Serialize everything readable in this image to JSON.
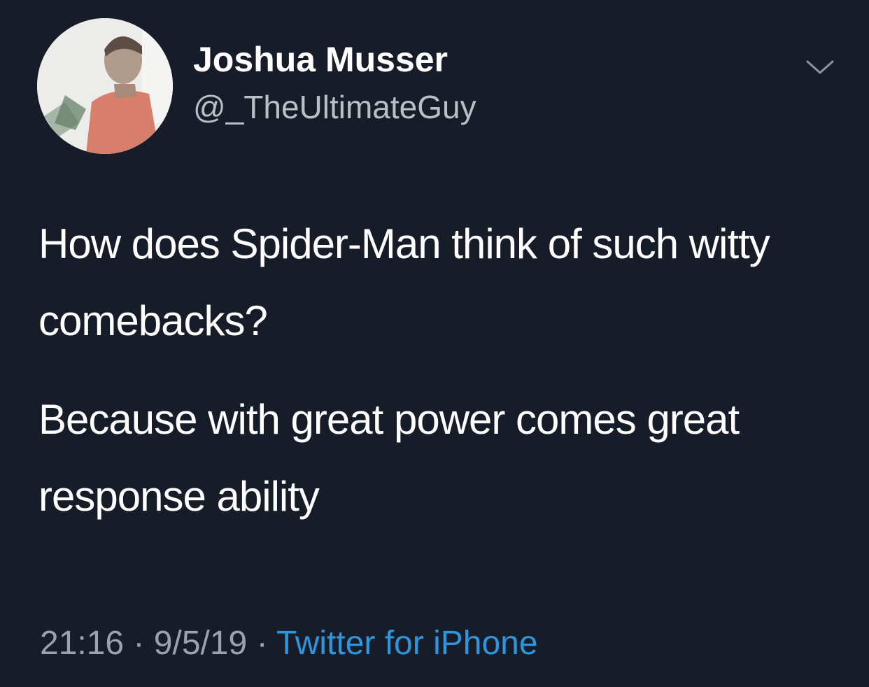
{
  "tweet": {
    "author": {
      "display_name": "Joshua Musser",
      "handle": "@_TheUltimateGuy"
    },
    "menu_icon": "chevron-down-icon",
    "body": {
      "line_1": "How does Spider-Man think of such witty comebacks?",
      "line_2": "Because with great power comes great response ability"
    },
    "meta": {
      "time": "21:16",
      "separator": " · ",
      "date": "9/5/19",
      "source": "Twitter for iPhone"
    }
  },
  "colors": {
    "background": "#171d28",
    "text_primary": "#ffffff",
    "text_secondary": "#9aa3ad",
    "link": "#2f95dc"
  }
}
